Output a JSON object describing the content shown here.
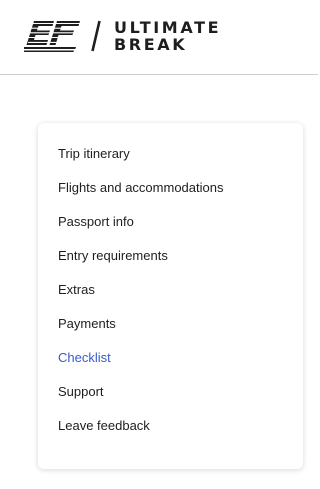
{
  "header": {
    "logo": {
      "mark_name": "ef-logo",
      "brand_line1": "ULTIMATE",
      "brand_line2": "BREAK"
    }
  },
  "menu": {
    "items": [
      {
        "label": "Trip itinerary",
        "active": false
      },
      {
        "label": "Flights and accommodations",
        "active": false
      },
      {
        "label": "Passport info",
        "active": false
      },
      {
        "label": "Entry requirements",
        "active": false
      },
      {
        "label": "Extras",
        "active": false
      },
      {
        "label": "Payments",
        "active": false
      },
      {
        "label": "Checklist",
        "active": true
      },
      {
        "label": "Support",
        "active": false
      },
      {
        "label": "Leave feedback",
        "active": false
      }
    ]
  },
  "colors": {
    "text": "#1e1e1e",
    "active_link": "#3a5bc7",
    "divider": "#cfcfcf"
  }
}
